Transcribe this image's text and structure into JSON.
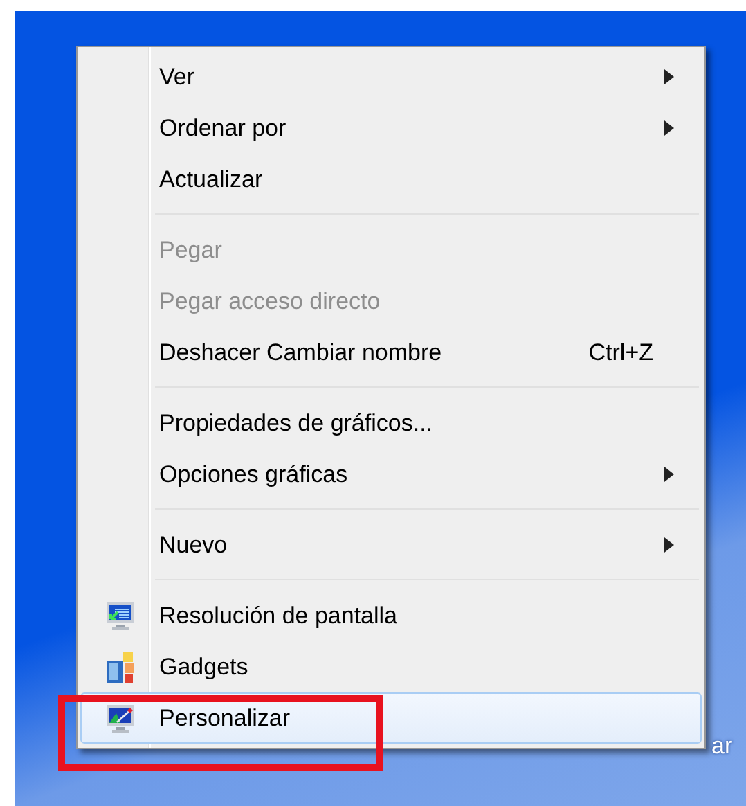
{
  "desktop": {
    "label_fragment": "ar"
  },
  "context_menu": {
    "items": [
      {
        "kind": "submenu",
        "label": "Ver",
        "disabled": false,
        "selected": false
      },
      {
        "kind": "submenu",
        "label": "Ordenar por",
        "disabled": false,
        "selected": false
      },
      {
        "kind": "command",
        "label": "Actualizar",
        "disabled": false,
        "selected": false
      },
      {
        "kind": "separator"
      },
      {
        "kind": "command",
        "label": "Pegar",
        "disabled": true,
        "selected": false
      },
      {
        "kind": "command",
        "label": "Pegar acceso directo",
        "disabled": true,
        "selected": false
      },
      {
        "kind": "command",
        "label": "Deshacer Cambiar nombre",
        "shortcut": "Ctrl+Z",
        "disabled": false,
        "selected": false
      },
      {
        "kind": "separator"
      },
      {
        "kind": "command",
        "label": "Propiedades de gráficos...",
        "disabled": false,
        "selected": false
      },
      {
        "kind": "submenu",
        "label": "Opciones gráficas",
        "disabled": false,
        "selected": false
      },
      {
        "kind": "separator"
      },
      {
        "kind": "submenu",
        "label": "Nuevo",
        "disabled": false,
        "selected": false
      },
      {
        "kind": "separator"
      },
      {
        "kind": "display",
        "label": "Resolución de pantalla",
        "disabled": false,
        "selected": false
      },
      {
        "kind": "gadgets",
        "label": "Gadgets",
        "disabled": false,
        "selected": false
      },
      {
        "kind": "personalize",
        "label": "Personalizar",
        "disabled": false,
        "selected": true
      }
    ]
  }
}
